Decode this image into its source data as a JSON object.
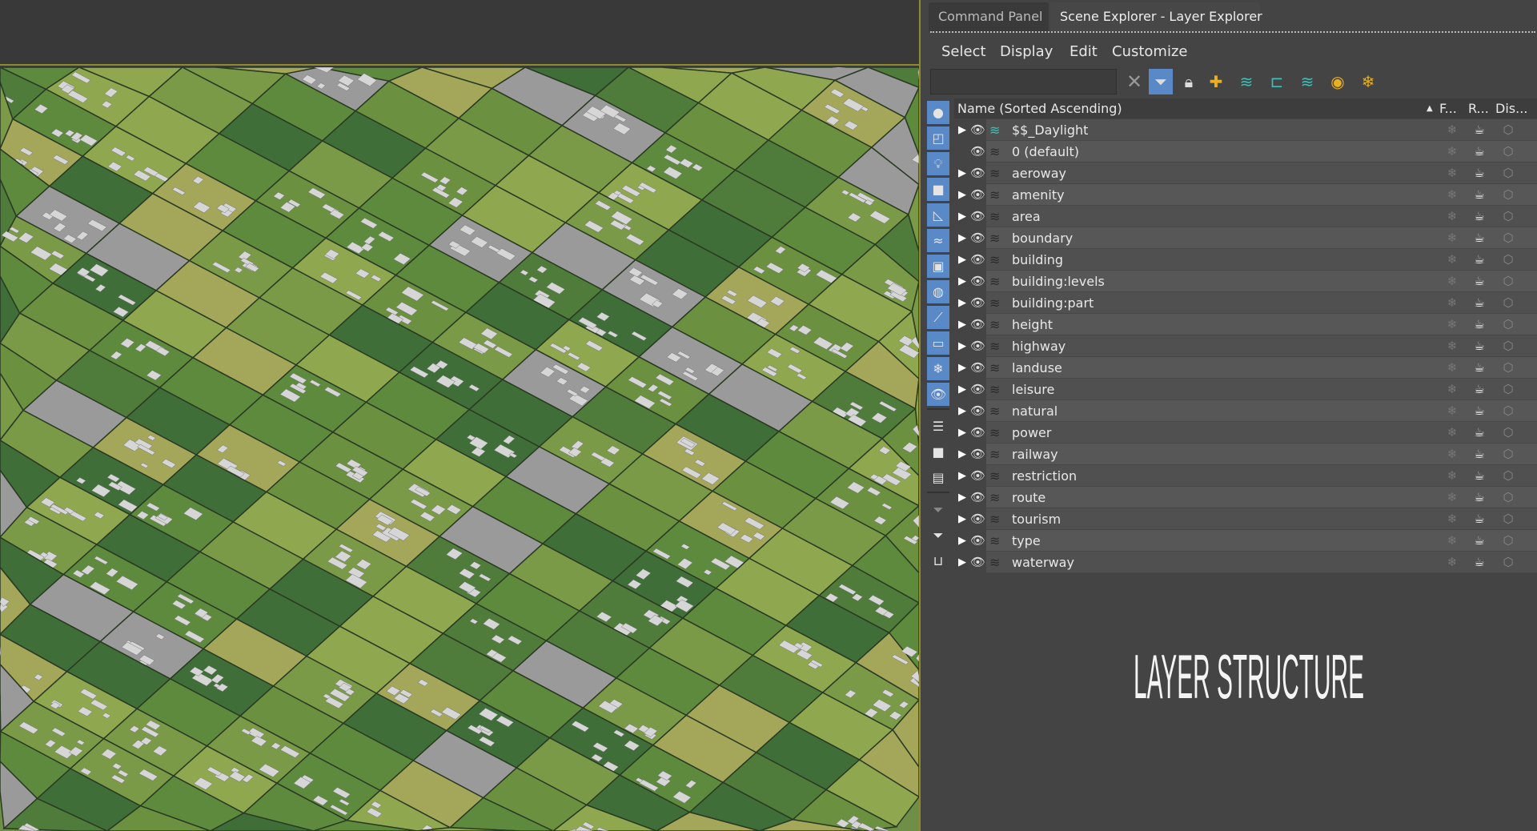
{
  "tabs": [
    {
      "label": "Command Panel"
    },
    {
      "label": "Scene Explorer - Layer Explorer"
    }
  ],
  "menu": [
    "Select",
    "Display",
    "Edit",
    "Customize"
  ],
  "search": {
    "value": "",
    "placeholder": ""
  },
  "toolbar": [
    "clear-x-icon",
    "filter-icon",
    "lock-icon",
    "add-layer-icon",
    "move-to-layer-icon",
    "hierarchy-icon",
    "layers-icon",
    "hide-layer-icon",
    "freeze-layer-icon"
  ],
  "columns": {
    "name": "Name (Sorted Ascending)",
    "sort": "▲",
    "freeze": "F...",
    "render": "R...",
    "display": "Dis..."
  },
  "layers": [
    {
      "name": "$$_Daylight",
      "expand": true,
      "active": true
    },
    {
      "name": "0 (default)",
      "expand": false
    },
    {
      "name": "aeroway",
      "expand": true
    },
    {
      "name": "amenity",
      "expand": true
    },
    {
      "name": "area",
      "expand": true
    },
    {
      "name": "boundary",
      "expand": true
    },
    {
      "name": "building",
      "expand": true
    },
    {
      "name": "building:levels",
      "expand": true
    },
    {
      "name": "building:part",
      "expand": true
    },
    {
      "name": "height",
      "expand": true
    },
    {
      "name": "highway",
      "expand": true
    },
    {
      "name": "landuse",
      "expand": true
    },
    {
      "name": "leisure",
      "expand": true
    },
    {
      "name": "natural",
      "expand": true
    },
    {
      "name": "power",
      "expand": true
    },
    {
      "name": "railway",
      "expand": true
    },
    {
      "name": "restriction",
      "expand": true
    },
    {
      "name": "route",
      "expand": true
    },
    {
      "name": "tourism",
      "expand": true
    },
    {
      "name": "type",
      "expand": true
    },
    {
      "name": "waterway",
      "expand": true
    }
  ],
  "caption": "LAYER STRUCTURE",
  "colors": {
    "accent": "#5a89c8",
    "active_layer": "#3cc0b8",
    "viewport_border": "#8f8a2c"
  }
}
